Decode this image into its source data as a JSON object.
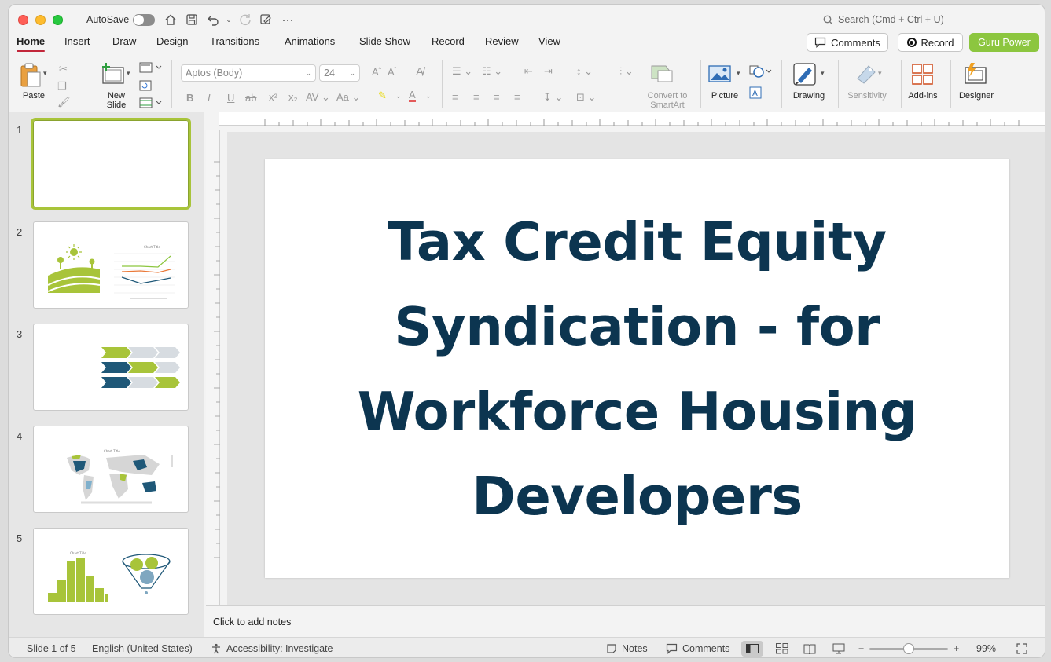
{
  "titlebar": {
    "autosave_label": "AutoSave",
    "search_placeholder": "Search (Cmd + Ctrl + U)"
  },
  "tabs": [
    "Home",
    "Insert",
    "Draw",
    "Design",
    "Transitions",
    "Animations",
    "Slide Show",
    "Record",
    "Review",
    "View"
  ],
  "header_buttons": {
    "comments": "Comments",
    "record": "Record",
    "guru": "Guru Power"
  },
  "ribbon": {
    "paste": "Paste",
    "new_slide_1": "New",
    "new_slide_2": "Slide",
    "font_name": "Aptos (Body)",
    "font_size": "24",
    "convert_1": "Convert to",
    "convert_2": "SmartArt",
    "picture": "Picture",
    "drawing": "Drawing",
    "sensitivity": "Sensitivity",
    "addins": "Add-ins",
    "designer": "Designer"
  },
  "thumbnails": [
    "1",
    "2",
    "3",
    "4",
    "5"
  ],
  "slide": {
    "title": "Tax Credit Equity Syndication - for Workforce Housing Developers"
  },
  "notes_placeholder": "Click to add notes",
  "status": {
    "slide_of": "Slide 1 of 5",
    "language": "English (United States)",
    "accessibility": "Accessibility: Investigate",
    "notes": "Notes",
    "comments": "Comments",
    "zoom": "99%"
  },
  "colors": {
    "accent_tab": "#c2263a",
    "guru": "#8cc63f",
    "title_text": "#0c3550",
    "green": "#a8c43a",
    "navy": "#1f5878"
  }
}
